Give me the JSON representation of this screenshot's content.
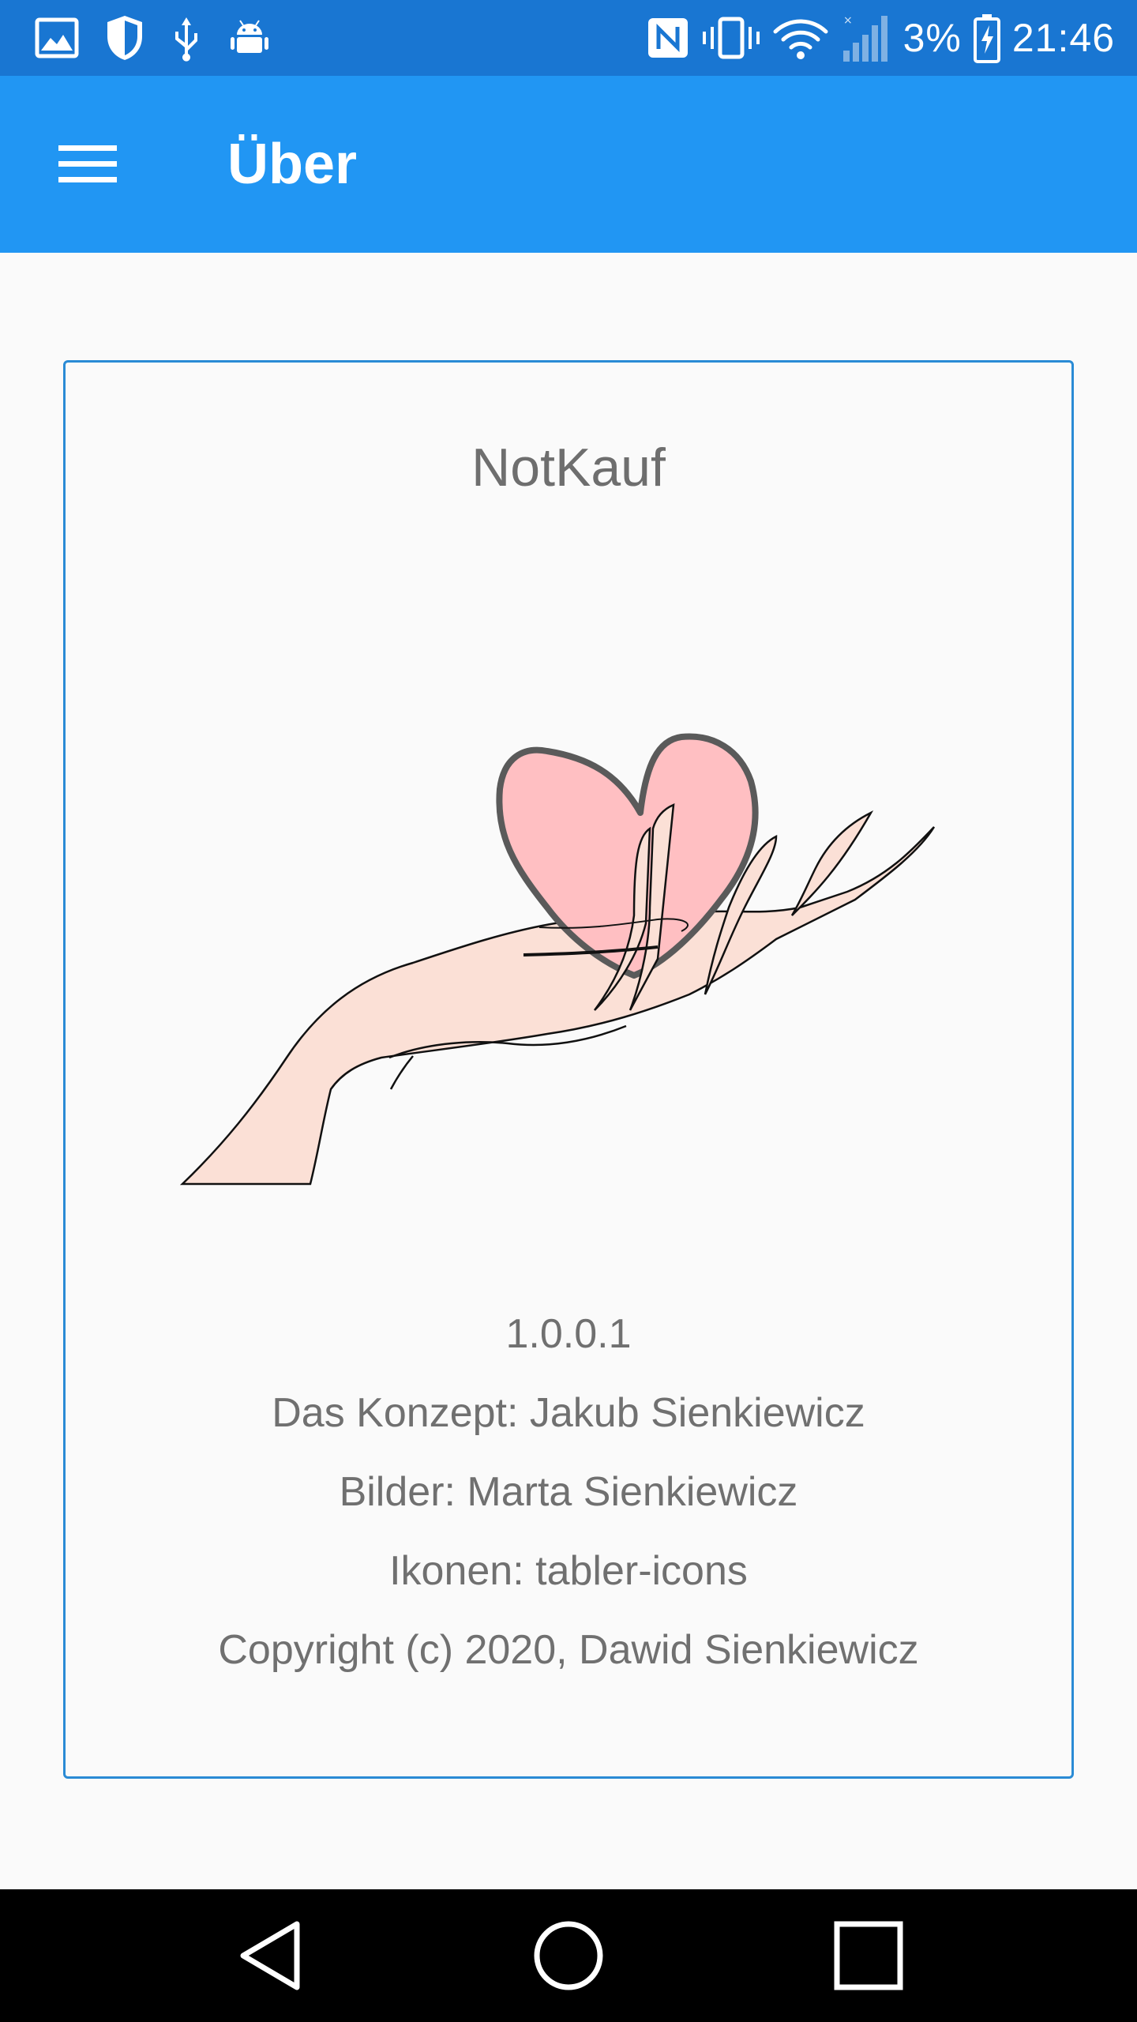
{
  "status_bar": {
    "left_icons": [
      "gallery-icon",
      "shield-icon",
      "usb-icon",
      "android-icon"
    ],
    "right_icons": [
      "nfc-icon",
      "vibrate-icon",
      "wifi-icon",
      "signal-icon",
      "battery-charging-icon"
    ],
    "battery_percent": "3%",
    "time": "21:46"
  },
  "app_bar": {
    "menu_icon": "hamburger-menu-icon",
    "title": "Über"
  },
  "about": {
    "app_name": "NotKauf",
    "illustration": "hand-holding-heart-illustration",
    "lines": [
      "1.0.0.1",
      "Das Konzept: Jakub Sienkiewicz",
      "Bilder: Marta Sienkiewicz",
      "Ikonen: tabler-icons",
      "Copyright (c) 2020, Dawid Sienkiewicz"
    ]
  },
  "colors": {
    "status_bar": "#1976d2",
    "app_bar": "#2196f3",
    "card_border": "#2a8bd5",
    "text_muted": "#707070",
    "heart_fill": "#ffbfc2",
    "skin_fill": "#fbe0d6"
  },
  "nav_bar": {
    "buttons": [
      "back-icon",
      "home-icon",
      "recent-apps-icon"
    ]
  }
}
